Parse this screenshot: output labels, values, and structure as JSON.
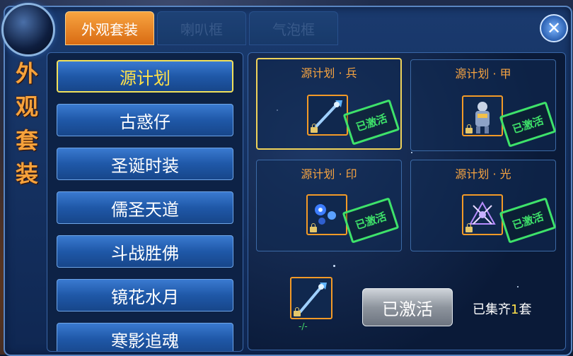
{
  "window": {
    "side_title": [
      "外",
      "观",
      "套",
      "装"
    ],
    "tabs": [
      {
        "label": "外观套装",
        "active": true
      },
      {
        "label": "喇叭框",
        "active": false
      },
      {
        "label": "气泡框",
        "active": false
      }
    ],
    "close_icon": "close-icon"
  },
  "suit_list": [
    {
      "label": "源计划",
      "selected": true
    },
    {
      "label": "古惑仔",
      "selected": false
    },
    {
      "label": "圣诞时装",
      "selected": false
    },
    {
      "label": "儒圣天道",
      "selected": false
    },
    {
      "label": "斗战胜佛",
      "selected": false
    },
    {
      "label": "镜花水月",
      "selected": false
    },
    {
      "label": "寒影追魂",
      "selected": false
    }
  ],
  "pieces": [
    {
      "title": "源计划 · 兵",
      "stamp": "已激活",
      "icon": "staff-weapon-icon",
      "selected": true
    },
    {
      "title": "源计划 · 甲",
      "stamp": "已激活",
      "icon": "armor-figure-icon",
      "selected": false
    },
    {
      "title": "源计划 · 印",
      "stamp": "已激活",
      "icon": "seal-orb-icon",
      "selected": false
    },
    {
      "title": "源计划 · 光",
      "stamp": "已激活",
      "icon": "light-aura-icon",
      "selected": false
    }
  ],
  "reward": {
    "icon": "staff-weapon-icon",
    "label": "-/-"
  },
  "activate_button": "已激活",
  "collected": {
    "prefix": "已集齐",
    "count": "1",
    "suffix": "套"
  },
  "colors": {
    "accent_orange": "#f7a441",
    "stamp_green": "#3ee26a",
    "selected_yellow": "#ffe24a"
  }
}
